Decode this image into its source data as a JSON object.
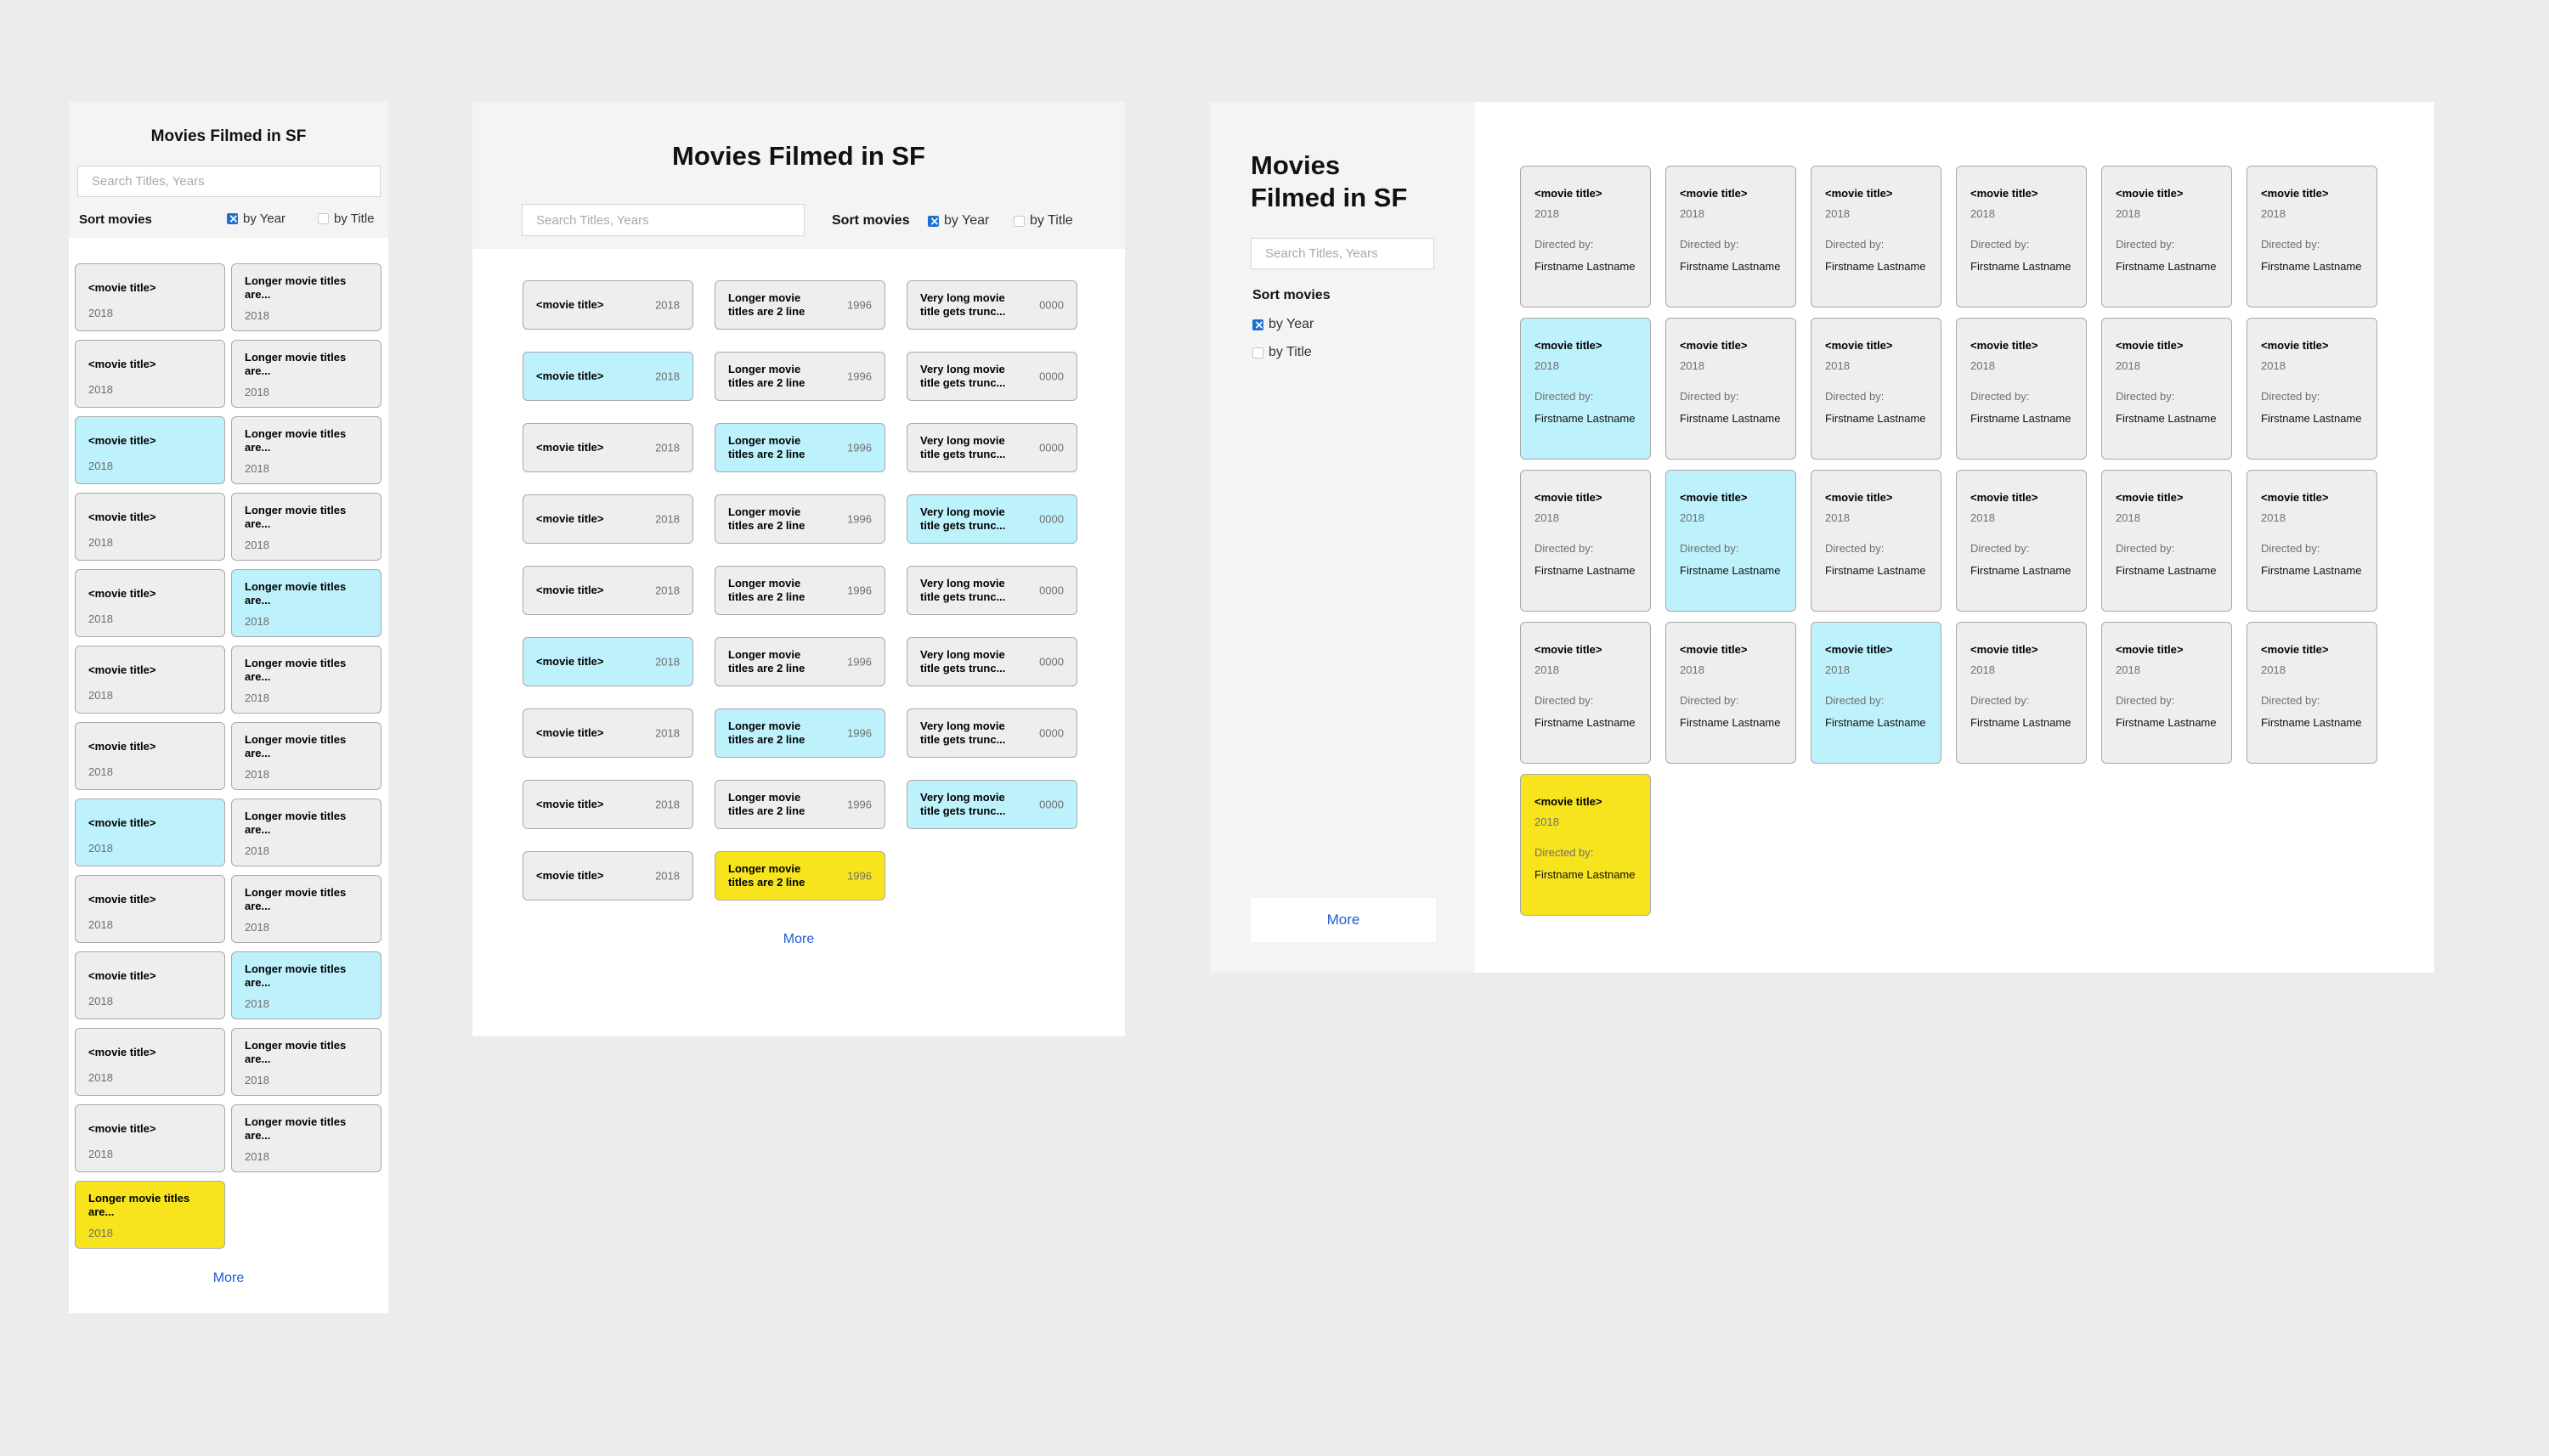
{
  "colors": {
    "background": "#ebecee",
    "card_default": "#eeeeee",
    "card_highlight": "#bdf1fc",
    "card_selected": "#f8e41c",
    "link": "#1e5fd0",
    "checkbox": "#1e6fd0"
  },
  "mobile": {
    "title": "Movies Filmed in SF",
    "search_placeholder": "Search Titles, Years",
    "sort_label": "Sort movies",
    "sort_options": [
      "by Year",
      "by Title"
    ],
    "more": "More",
    "cards": [
      {
        "title": "<movie title>",
        "year": "2018",
        "state": "default"
      },
      {
        "title": "Longer movie titles are...",
        "year": "2018",
        "state": "default"
      },
      {
        "title": "<movie title>",
        "year": "2018",
        "state": "default"
      },
      {
        "title": "Longer movie titles are...",
        "year": "2018",
        "state": "default"
      },
      {
        "title": "<movie title>",
        "year": "2018",
        "state": "highlight"
      },
      {
        "title": "Longer movie titles are...",
        "year": "2018",
        "state": "default"
      },
      {
        "title": "<movie title>",
        "year": "2018",
        "state": "default"
      },
      {
        "title": "Longer movie titles are...",
        "year": "2018",
        "state": "default"
      },
      {
        "title": "<movie title>",
        "year": "2018",
        "state": "default"
      },
      {
        "title": "Longer movie titles are...",
        "year": "2018",
        "state": "highlight"
      },
      {
        "title": "<movie title>",
        "year": "2018",
        "state": "default"
      },
      {
        "title": "Longer movie titles are...",
        "year": "2018",
        "state": "default"
      },
      {
        "title": "<movie title>",
        "year": "2018",
        "state": "default"
      },
      {
        "title": "Longer movie titles are...",
        "year": "2018",
        "state": "default"
      },
      {
        "title": "<movie title>",
        "year": "2018",
        "state": "highlight"
      },
      {
        "title": "Longer movie titles are...",
        "year": "2018",
        "state": "default"
      },
      {
        "title": "<movie title>",
        "year": "2018",
        "state": "default"
      },
      {
        "title": "Longer movie titles are...",
        "year": "2018",
        "state": "default"
      },
      {
        "title": "<movie title>",
        "year": "2018",
        "state": "default"
      },
      {
        "title": "Longer movie titles are...",
        "year": "2018",
        "state": "highlight"
      },
      {
        "title": "<movie title>",
        "year": "2018",
        "state": "default"
      },
      {
        "title": "Longer movie titles are...",
        "year": "2018",
        "state": "default"
      },
      {
        "title": "<movie title>",
        "year": "2018",
        "state": "default"
      },
      {
        "title": "Longer movie titles are...",
        "year": "2018",
        "state": "default"
      },
      {
        "title": "Longer movie titles are...",
        "year": "2018",
        "state": "selected"
      }
    ]
  },
  "tablet": {
    "title": "Movies Filmed in SF",
    "search_placeholder": "Search Titles, Years",
    "sort_label": "Sort movies",
    "sort_options": [
      "by Year",
      "by Title"
    ],
    "more": "More",
    "cards": [
      {
        "title": "<movie title>",
        "year": "2018",
        "state": "default"
      },
      {
        "title": "Longer movie titles are 2 line",
        "year": "1996",
        "state": "default"
      },
      {
        "title": "Very long movie title gets trunc...",
        "year": "0000",
        "state": "default"
      },
      {
        "title": "<movie title>",
        "year": "2018",
        "state": "highlight"
      },
      {
        "title": "Longer movie titles are 2 line",
        "year": "1996",
        "state": "default"
      },
      {
        "title": "Very long movie title gets trunc...",
        "year": "0000",
        "state": "default"
      },
      {
        "title": "<movie title>",
        "year": "2018",
        "state": "default"
      },
      {
        "title": "Longer movie titles are 2 line",
        "year": "1996",
        "state": "highlight"
      },
      {
        "title": "Very long movie title gets trunc...",
        "year": "0000",
        "state": "default"
      },
      {
        "title": "<movie title>",
        "year": "2018",
        "state": "default"
      },
      {
        "title": "Longer movie titles are 2 line",
        "year": "1996",
        "state": "default"
      },
      {
        "title": "Very long movie title gets trunc...",
        "year": "0000",
        "state": "highlight"
      },
      {
        "title": "<movie title>",
        "year": "2018",
        "state": "default"
      },
      {
        "title": "Longer movie titles are 2 line",
        "year": "1996",
        "state": "default"
      },
      {
        "title": "Very long movie title gets trunc...",
        "year": "0000",
        "state": "default"
      },
      {
        "title": "<movie title>",
        "year": "2018",
        "state": "highlight"
      },
      {
        "title": "Longer movie titles are 2 line",
        "year": "1996",
        "state": "default"
      },
      {
        "title": "Very long movie title gets trunc...",
        "year": "0000",
        "state": "default"
      },
      {
        "title": "<movie title>",
        "year": "2018",
        "state": "default"
      },
      {
        "title": "Longer movie titles are 2 line",
        "year": "1996",
        "state": "highlight"
      },
      {
        "title": "Very long movie title gets trunc...",
        "year": "0000",
        "state": "default"
      },
      {
        "title": "<movie title>",
        "year": "2018",
        "state": "default"
      },
      {
        "title": "Longer movie titles are 2 line",
        "year": "1996",
        "state": "default"
      },
      {
        "title": "Very long movie title gets trunc...",
        "year": "0000",
        "state": "highlight"
      },
      {
        "title": "<movie title>",
        "year": "2018",
        "state": "default"
      },
      {
        "title": "Longer movie titles are 2 line",
        "year": "1996",
        "state": "selected"
      }
    ]
  },
  "desktop": {
    "title": "Movies Filmed in SF",
    "search_placeholder": "Search Titles, Years",
    "sort_label": "Sort movies",
    "sort_options": [
      "by Year",
      "by Title"
    ],
    "more": "More",
    "directed_by_label": "Directed by:",
    "cards": [
      {
        "title": "<movie title>",
        "year": "2018",
        "director": "Firstname Lastname",
        "state": "default"
      },
      {
        "title": "<movie title>",
        "year": "2018",
        "director": "Firstname Lastname",
        "state": "default"
      },
      {
        "title": "<movie title>",
        "year": "2018",
        "director": "Firstname Lastname",
        "state": "default"
      },
      {
        "title": "<movie title>",
        "year": "2018",
        "director": "Firstname Lastname",
        "state": "default"
      },
      {
        "title": "<movie title>",
        "year": "2018",
        "director": "Firstname Lastname",
        "state": "default"
      },
      {
        "title": "<movie title>",
        "year": "2018",
        "director": "Firstname Lastname",
        "state": "default"
      },
      {
        "title": "<movie title>",
        "year": "2018",
        "director": "Firstname Lastname",
        "state": "highlight"
      },
      {
        "title": "<movie title>",
        "year": "2018",
        "director": "Firstname Lastname",
        "state": "default"
      },
      {
        "title": "<movie title>",
        "year": "2018",
        "director": "Firstname Lastname",
        "state": "default"
      },
      {
        "title": "<movie title>",
        "year": "2018",
        "director": "Firstname Lastname",
        "state": "default"
      },
      {
        "title": "<movie title>",
        "year": "2018",
        "director": "Firstname Lastname",
        "state": "default"
      },
      {
        "title": "<movie title>",
        "year": "2018",
        "director": "Firstname Lastname",
        "state": "default"
      },
      {
        "title": "<movie title>",
        "year": "2018",
        "director": "Firstname Lastname",
        "state": "default"
      },
      {
        "title": "<movie title>",
        "year": "2018",
        "director": "Firstname Lastname",
        "state": "highlight"
      },
      {
        "title": "<movie title>",
        "year": "2018",
        "director": "Firstname Lastname",
        "state": "default"
      },
      {
        "title": "<movie title>",
        "year": "2018",
        "director": "Firstname Lastname",
        "state": "default"
      },
      {
        "title": "<movie title>",
        "year": "2018",
        "director": "Firstname Lastname",
        "state": "default"
      },
      {
        "title": "<movie title>",
        "year": "2018",
        "director": "Firstname Lastname",
        "state": "default"
      },
      {
        "title": "<movie title>",
        "year": "2018",
        "director": "Firstname Lastname",
        "state": "default"
      },
      {
        "title": "<movie title>",
        "year": "2018",
        "director": "Firstname Lastname",
        "state": "default"
      },
      {
        "title": "<movie title>",
        "year": "2018",
        "director": "Firstname Lastname",
        "state": "highlight"
      },
      {
        "title": "<movie title>",
        "year": "2018",
        "director": "Firstname Lastname",
        "state": "default"
      },
      {
        "title": "<movie title>",
        "year": "2018",
        "director": "Firstname Lastname",
        "state": "default"
      },
      {
        "title": "<movie title>",
        "year": "2018",
        "director": "Firstname Lastname",
        "state": "default"
      },
      {
        "title": "<movie title>",
        "year": "2018",
        "director": "Firstname Lastname",
        "state": "selected"
      }
    ]
  }
}
